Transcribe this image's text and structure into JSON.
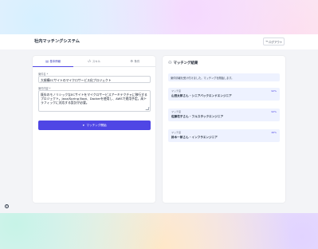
{
  "header": {
    "app_title": "社内マッチングシステム",
    "logout_label": "ログアウト",
    "logout_icon": "logout-icon"
  },
  "tabs": [
    {
      "label": "基本情報",
      "icon": "document-icon",
      "active": true
    },
    {
      "label": "スキル",
      "icon": "code-icon",
      "active": false
    },
    {
      "label": "条件",
      "icon": "settings-icon",
      "active": false
    }
  ],
  "form": {
    "project_name_label": "案件名 *",
    "project_name_value": "大規模ECサイトのマイクロサービス化プロジェクト",
    "project_desc_label": "案件内容 *",
    "project_desc_value": "既存のモノリシックなECサイトをマイクロサービスアーキテクチャに移行するプロジェクト。Java/Spring Boot、Dockerを使用し、AWSで運用予定。高トラフィックに対応する設計が必要。",
    "submit_label": "マッチング開始"
  },
  "results": {
    "title": "マッチング結果",
    "notice": "案件情報を受け付けました。マッチングを開始します。",
    "items": [
      {
        "label": "マッチ度",
        "percent": "92%",
        "name": "山田太郎さん - シニアバックエンドエンジニア"
      },
      {
        "label": "マッチ度",
        "percent": "92%",
        "name": "佐藤花子さん - フルスタックエンジニア"
      },
      {
        "label": "マッチ度",
        "percent": "46%",
        "name": "鈴木一郎さん - インフラエンジニア"
      }
    ]
  },
  "colors": {
    "accent": "#4f46e5",
    "result_bg": "#eef2ff"
  }
}
